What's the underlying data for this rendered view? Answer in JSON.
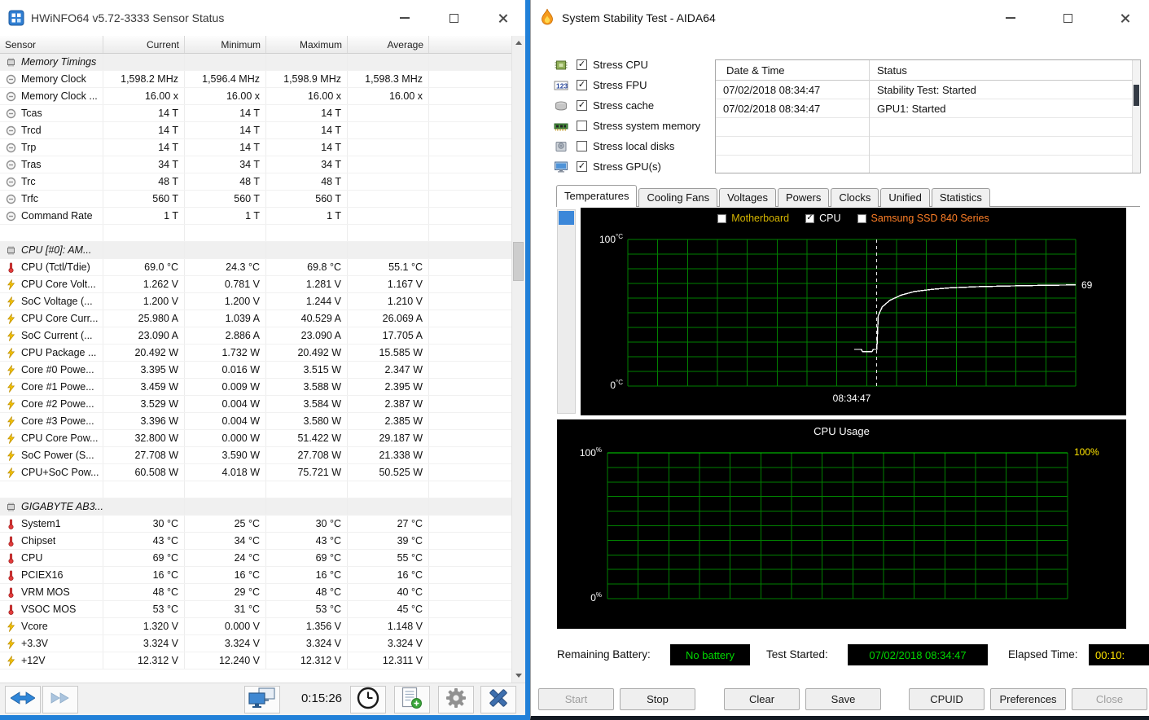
{
  "colors": {
    "hwinfo_border": "#2180d8",
    "chart_background": "#000000",
    "chart_grid": "#008000",
    "badge_green": "#00d800",
    "badge_yellow": "#ffe400"
  },
  "hwinfo": {
    "title": "HWiNFO64 v5.72-3333 Sensor Status",
    "columns": [
      "Sensor",
      "Current",
      "Minimum",
      "Maximum",
      "Average"
    ],
    "rows": [
      {
        "type": "section",
        "icon": "chip",
        "name": "Memory Timings"
      },
      {
        "type": "row",
        "icon": "gauge",
        "name": "Memory Clock",
        "values": [
          "1,598.2 MHz",
          "1,596.4 MHz",
          "1,598.9 MHz",
          "1,598.3 MHz"
        ]
      },
      {
        "type": "row",
        "icon": "gauge",
        "name": "Memory Clock ...",
        "values": [
          "16.00 x",
          "16.00 x",
          "16.00 x",
          "16.00 x"
        ]
      },
      {
        "type": "row",
        "icon": "gauge",
        "name": "Tcas",
        "values": [
          "14 T",
          "14 T",
          "14 T",
          ""
        ]
      },
      {
        "type": "row",
        "icon": "gauge",
        "name": "Trcd",
        "values": [
          "14 T",
          "14 T",
          "14 T",
          ""
        ]
      },
      {
        "type": "row",
        "icon": "gauge",
        "name": "Trp",
        "values": [
          "14 T",
          "14 T",
          "14 T",
          ""
        ]
      },
      {
        "type": "row",
        "icon": "gauge",
        "name": "Tras",
        "values": [
          "34 T",
          "34 T",
          "34 T",
          ""
        ]
      },
      {
        "type": "row",
        "icon": "gauge",
        "name": "Trc",
        "values": [
          "48 T",
          "48 T",
          "48 T",
          ""
        ]
      },
      {
        "type": "row",
        "icon": "gauge",
        "name": "Trfc",
        "values": [
          "560 T",
          "560 T",
          "560 T",
          ""
        ]
      },
      {
        "type": "row",
        "icon": "gauge",
        "name": "Command Rate",
        "values": [
          "1 T",
          "1 T",
          "1 T",
          ""
        ]
      },
      {
        "type": "spacer"
      },
      {
        "type": "section",
        "icon": "chip",
        "name": "CPU [#0]: AM..."
      },
      {
        "type": "row",
        "icon": "thermo",
        "name": "CPU (Tctl/Tdie)",
        "values": [
          "69.0 °C",
          "24.3 °C",
          "69.8 °C",
          "55.1 °C"
        ]
      },
      {
        "type": "row",
        "icon": "bolt",
        "name": "CPU Core Volt...",
        "values": [
          "1.262 V",
          "0.781 V",
          "1.281 V",
          "1.167 V"
        ]
      },
      {
        "type": "row",
        "icon": "bolt",
        "name": "SoC Voltage (...",
        "values": [
          "1.200 V",
          "1.200 V",
          "1.244 V",
          "1.210 V"
        ]
      },
      {
        "type": "row",
        "icon": "bolt",
        "name": "CPU Core Curr...",
        "values": [
          "25.980 A",
          "1.039 A",
          "40.529 A",
          "26.069 A"
        ]
      },
      {
        "type": "row",
        "icon": "bolt",
        "name": "SoC Current (...",
        "values": [
          "23.090 A",
          "2.886 A",
          "23.090 A",
          "17.705 A"
        ]
      },
      {
        "type": "row",
        "icon": "bolt",
        "name": "CPU Package ...",
        "values": [
          "20.492 W",
          "1.732 W",
          "20.492 W",
          "15.585 W"
        ]
      },
      {
        "type": "row",
        "icon": "bolt",
        "name": "Core #0 Powe...",
        "values": [
          "3.395 W",
          "0.016 W",
          "3.515 W",
          "2.347 W"
        ]
      },
      {
        "type": "row",
        "icon": "bolt",
        "name": "Core #1 Powe...",
        "values": [
          "3.459 W",
          "0.009 W",
          "3.588 W",
          "2.395 W"
        ]
      },
      {
        "type": "row",
        "icon": "bolt",
        "name": "Core #2 Powe...",
        "values": [
          "3.529 W",
          "0.004 W",
          "3.584 W",
          "2.387 W"
        ]
      },
      {
        "type": "row",
        "icon": "bolt",
        "name": "Core #3 Powe...",
        "values": [
          "3.396 W",
          "0.004 W",
          "3.580 W",
          "2.385 W"
        ]
      },
      {
        "type": "row",
        "icon": "bolt",
        "name": "CPU Core Pow...",
        "values": [
          "32.800 W",
          "0.000 W",
          "51.422 W",
          "29.187 W"
        ]
      },
      {
        "type": "row",
        "icon": "bolt",
        "name": "SoC Power (S...",
        "values": [
          "27.708 W",
          "3.590 W",
          "27.708 W",
          "21.338 W"
        ]
      },
      {
        "type": "row",
        "icon": "bolt",
        "name": "CPU+SoC Pow...",
        "values": [
          "60.508 W",
          "4.018 W",
          "75.721 W",
          "50.525 W"
        ]
      },
      {
        "type": "spacer"
      },
      {
        "type": "section",
        "icon": "chip",
        "name": "GIGABYTE AB3..."
      },
      {
        "type": "row",
        "icon": "thermo",
        "name": "System1",
        "values": [
          "30 °C",
          "25 °C",
          "30 °C",
          "27 °C"
        ]
      },
      {
        "type": "row",
        "icon": "thermo",
        "name": "Chipset",
        "values": [
          "43 °C",
          "34 °C",
          "43 °C",
          "39 °C"
        ]
      },
      {
        "type": "row",
        "icon": "thermo",
        "name": "CPU",
        "values": [
          "69 °C",
          "24 °C",
          "69 °C",
          "55 °C"
        ]
      },
      {
        "type": "row",
        "icon": "thermo",
        "name": "PCIEX16",
        "values": [
          "16 °C",
          "16 °C",
          "16 °C",
          "16 °C"
        ]
      },
      {
        "type": "row",
        "icon": "thermo",
        "name": "VRM MOS",
        "values": [
          "48 °C",
          "29 °C",
          "48 °C",
          "40 °C"
        ]
      },
      {
        "type": "row",
        "icon": "thermo",
        "name": "VSOC MOS",
        "values": [
          "53 °C",
          "31 °C",
          "53 °C",
          "45 °C"
        ]
      },
      {
        "type": "row",
        "icon": "bolt",
        "name": "Vcore",
        "values": [
          "1.320 V",
          "0.000 V",
          "1.356 V",
          "1.148 V"
        ]
      },
      {
        "type": "row",
        "icon": "bolt",
        "name": "+3.3V",
        "values": [
          "3.324 V",
          "3.324 V",
          "3.324 V",
          "3.324 V"
        ]
      },
      {
        "type": "row",
        "icon": "bolt",
        "name": "+12V",
        "values": [
          "12.312 V",
          "12.240 V",
          "12.312 V",
          "12.311 V"
        ]
      }
    ],
    "toolbar": {
      "elapsed": "0:15:26",
      "icons": [
        "nav-arrows",
        "nav-forward",
        "remote-monitors",
        "clock",
        "report-add",
        "settings-gear",
        "close-x"
      ]
    }
  },
  "aida": {
    "title": "System Stability Test - AIDA64",
    "stress_options": [
      {
        "label": "Stress CPU",
        "checked": true,
        "icon": "cpu"
      },
      {
        "label": "Stress FPU",
        "checked": true,
        "icon": "fpu"
      },
      {
        "label": "Stress cache",
        "checked": true,
        "icon": "cache"
      },
      {
        "label": "Stress system memory",
        "checked": false,
        "icon": "memory"
      },
      {
        "label": "Stress local disks",
        "checked": false,
        "icon": "disk"
      },
      {
        "label": "Stress GPU(s)",
        "checked": true,
        "icon": "gpu"
      }
    ],
    "log": {
      "columns": [
        "Date & Time",
        "Status"
      ],
      "rows": [
        {
          "datetime": "07/02/2018 08:34:47",
          "status": "Stability Test: Started"
        },
        {
          "datetime": "07/02/2018 08:34:47",
          "status": "GPU1: Started"
        }
      ]
    },
    "tabs": [
      {
        "label": "Temperatures",
        "selected": true
      },
      {
        "label": "Cooling Fans",
        "selected": false
      },
      {
        "label": "Voltages",
        "selected": false
      },
      {
        "label": "Powers",
        "selected": false
      },
      {
        "label": "Clocks",
        "selected": false
      },
      {
        "label": "Unified",
        "selected": false
      },
      {
        "label": "Statistics",
        "selected": false
      }
    ],
    "status_bar": {
      "battery_label": "Remaining Battery:",
      "battery_value": "No battery",
      "test_started_label": "Test Started:",
      "test_started_value": "07/02/2018 08:34:47",
      "elapsed_label": "Elapsed Time:",
      "elapsed_value": "00:10:"
    },
    "action_buttons": [
      {
        "label": "Start",
        "disabled": true
      },
      {
        "label": "Stop",
        "disabled": false
      },
      {
        "label": "Clear",
        "disabled": false
      },
      {
        "label": "Save",
        "disabled": false
      },
      {
        "label": "CPUID",
        "disabled": false
      },
      {
        "label": "Preferences",
        "disabled": false
      },
      {
        "label": "Close",
        "disabled": true
      }
    ]
  },
  "chart_data": [
    {
      "id": "temperature",
      "type": "line",
      "title": "",
      "legend": [
        {
          "label": "Motherboard",
          "checked": false,
          "color": "#d4b400"
        },
        {
          "label": "CPU",
          "checked": true,
          "color": "#ffffff"
        },
        {
          "label": "Samsung SSD 840 Series",
          "checked": false,
          "color": "#ff7f27"
        }
      ],
      "ylim": [
        0,
        100
      ],
      "y_top_label": "100",
      "y_bottom_label": "0",
      "y_unit": "°C",
      "xlabel": "08:34:47",
      "grid": {
        "h_divisions": 10,
        "v_divisions": 15,
        "color": "#008000"
      },
      "marker_x": 0.555,
      "end_label": {
        "text": "69",
        "value": 69
      },
      "series": [
        {
          "name": "CPU",
          "color": "#ffffff",
          "points": [
            [
              0.505,
              25
            ],
            [
              0.521,
              25
            ],
            [
              0.524,
              23.5
            ],
            [
              0.545,
              23.5
            ],
            [
              0.548,
              25
            ],
            [
              0.556,
              25
            ],
            [
              0.559,
              48
            ],
            [
              0.568,
              54
            ],
            [
              0.585,
              58.5
            ],
            [
              0.61,
              62
            ],
            [
              0.64,
              64.5
            ],
            [
              0.68,
              66
            ],
            [
              0.72,
              67
            ],
            [
              0.78,
              67.8
            ],
            [
              0.85,
              68.3
            ],
            [
              0.93,
              68.7
            ],
            [
              1,
              69
            ]
          ]
        }
      ]
    },
    {
      "id": "cpu-usage",
      "type": "line",
      "title": "CPU Usage",
      "ylim": [
        0,
        100
      ],
      "y_top_label": "100",
      "y_bottom_label": "0",
      "y_unit": "%",
      "right_label": {
        "text": "100%",
        "color": "#ffe400"
      },
      "grid": {
        "h_divisions": 10,
        "v_divisions": 15,
        "color": "#008000"
      },
      "series": [
        {
          "name": "CPU Usage",
          "color": "#00dc00",
          "points": [
            [
              0,
              100
            ],
            [
              1,
              100
            ]
          ]
        }
      ]
    }
  ]
}
